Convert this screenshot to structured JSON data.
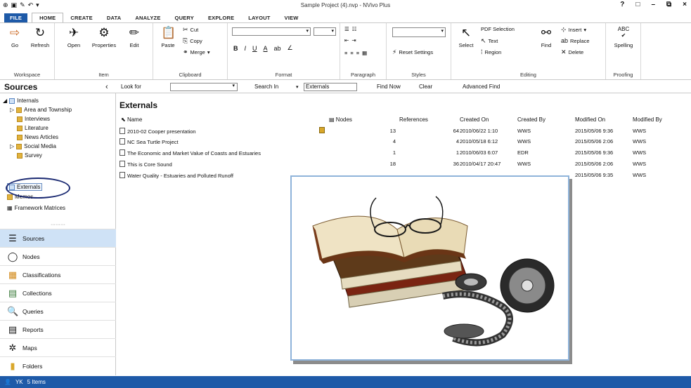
{
  "window": {
    "title": "Sample Project (4).nvp - NVivo Plus",
    "controls": [
      "?",
      "□",
      "–",
      "⧉",
      "×"
    ]
  },
  "menu": {
    "tabs": [
      "FILE",
      "HOME",
      "CREATE",
      "DATA",
      "ANALYZE",
      "QUERY",
      "EXPLORE",
      "LAYOUT",
      "VIEW"
    ]
  },
  "ribbon": {
    "workspace": {
      "label": "Workspace",
      "go": "Go",
      "refresh": "Refresh"
    },
    "item": {
      "label": "Item",
      "open": "Open",
      "properties": "Properties",
      "edit": "Edit"
    },
    "clipboard": {
      "label": "Clipboard",
      "paste": "Paste",
      "cut": "Cut",
      "copy": "Copy",
      "merge": "Merge"
    },
    "format": {
      "label": "Format"
    },
    "paragraph": {
      "label": "Paragraph"
    },
    "styles": {
      "label": "Styles",
      "reset": "Reset Settings"
    },
    "editing": {
      "label": "Editing",
      "select": "Select",
      "pdf_selection": "PDF Selection",
      "text": "Text",
      "region": "Region",
      "find": "Find",
      "insert": "Insert",
      "replace": "Replace",
      "delete": "Delete"
    },
    "proofing": {
      "label": "Proofing",
      "spelling": "Spelling",
      "abc": "ABC"
    }
  },
  "findbar": {
    "look_for": "Look for",
    "search_in": "Search In",
    "search_in_value": "Externals",
    "find_now": "Find Now",
    "clear": "Clear",
    "advanced_find": "Advanced Find"
  },
  "sources_pane": {
    "title": "Sources",
    "tree": [
      {
        "label": "Internals"
      },
      {
        "label": "Area and Township"
      },
      {
        "label": "Interviews"
      },
      {
        "label": "Literature"
      },
      {
        "label": "News Articles"
      },
      {
        "label": "Social Media"
      },
      {
        "label": "Survey"
      },
      {
        "label": "Externals"
      },
      {
        "label": "Memos"
      },
      {
        "label": "Framework Matrices"
      }
    ]
  },
  "nav": [
    {
      "label": "Sources",
      "icon": "sources-icon"
    },
    {
      "label": "Nodes",
      "icon": "nodes-icon"
    },
    {
      "label": "Classifications",
      "icon": "classifications-icon"
    },
    {
      "label": "Collections",
      "icon": "collections-icon"
    },
    {
      "label": "Queries",
      "icon": "queries-icon"
    },
    {
      "label": "Reports",
      "icon": "reports-icon"
    },
    {
      "label": "Maps",
      "icon": "maps-icon"
    },
    {
      "label": "Folders",
      "icon": "folders-icon"
    }
  ],
  "list": {
    "title": "Externals",
    "columns": [
      "Name",
      "Nodes",
      "References",
      "Created On",
      "Created By",
      "Modified On",
      "Modified By"
    ],
    "rows": [
      {
        "name": "2010-02 Cooper presentation",
        "nodes": "13",
        "references": "64",
        "created_on": "2010/06/22 1:10",
        "created_by": "WWS",
        "modified_on": "2015/05/06 9:36",
        "modified_by": "WWS"
      },
      {
        "name": "NC Sea Turtle Project",
        "nodes": "4",
        "references": "4",
        "created_on": "2010/05/18 6:12",
        "created_by": "WWS",
        "modified_on": "2015/05/06 2:06",
        "modified_by": "WWS"
      },
      {
        "name": "The Economic and Market Value of Coasts and Estuaries",
        "nodes": "1",
        "references": "1",
        "created_on": "2010/06/03 6:07",
        "created_by": "EDR",
        "modified_on": "2015/05/06 9:36",
        "modified_by": "WWS"
      },
      {
        "name": "This is Core Sound",
        "nodes": "18",
        "references": "36",
        "created_on": "2010/04/17 20:47",
        "created_by": "WWS",
        "modified_on": "2015/05/06 2:06",
        "modified_by": "WWS"
      },
      {
        "name": "Water Quality - Estuaries and Polluted Runoff",
        "nodes": "",
        "references": "",
        "created_on": "",
        "created_by": "",
        "modified_on": "2015/05/06 9:35",
        "modified_by": "WWS"
      }
    ]
  },
  "statusbar": {
    "user": "YK",
    "items": "5 Items"
  },
  "colors": {
    "accent": "#1e5aa8",
    "selected_nav": "#cfe2f6",
    "oval": "#1b2a72"
  }
}
